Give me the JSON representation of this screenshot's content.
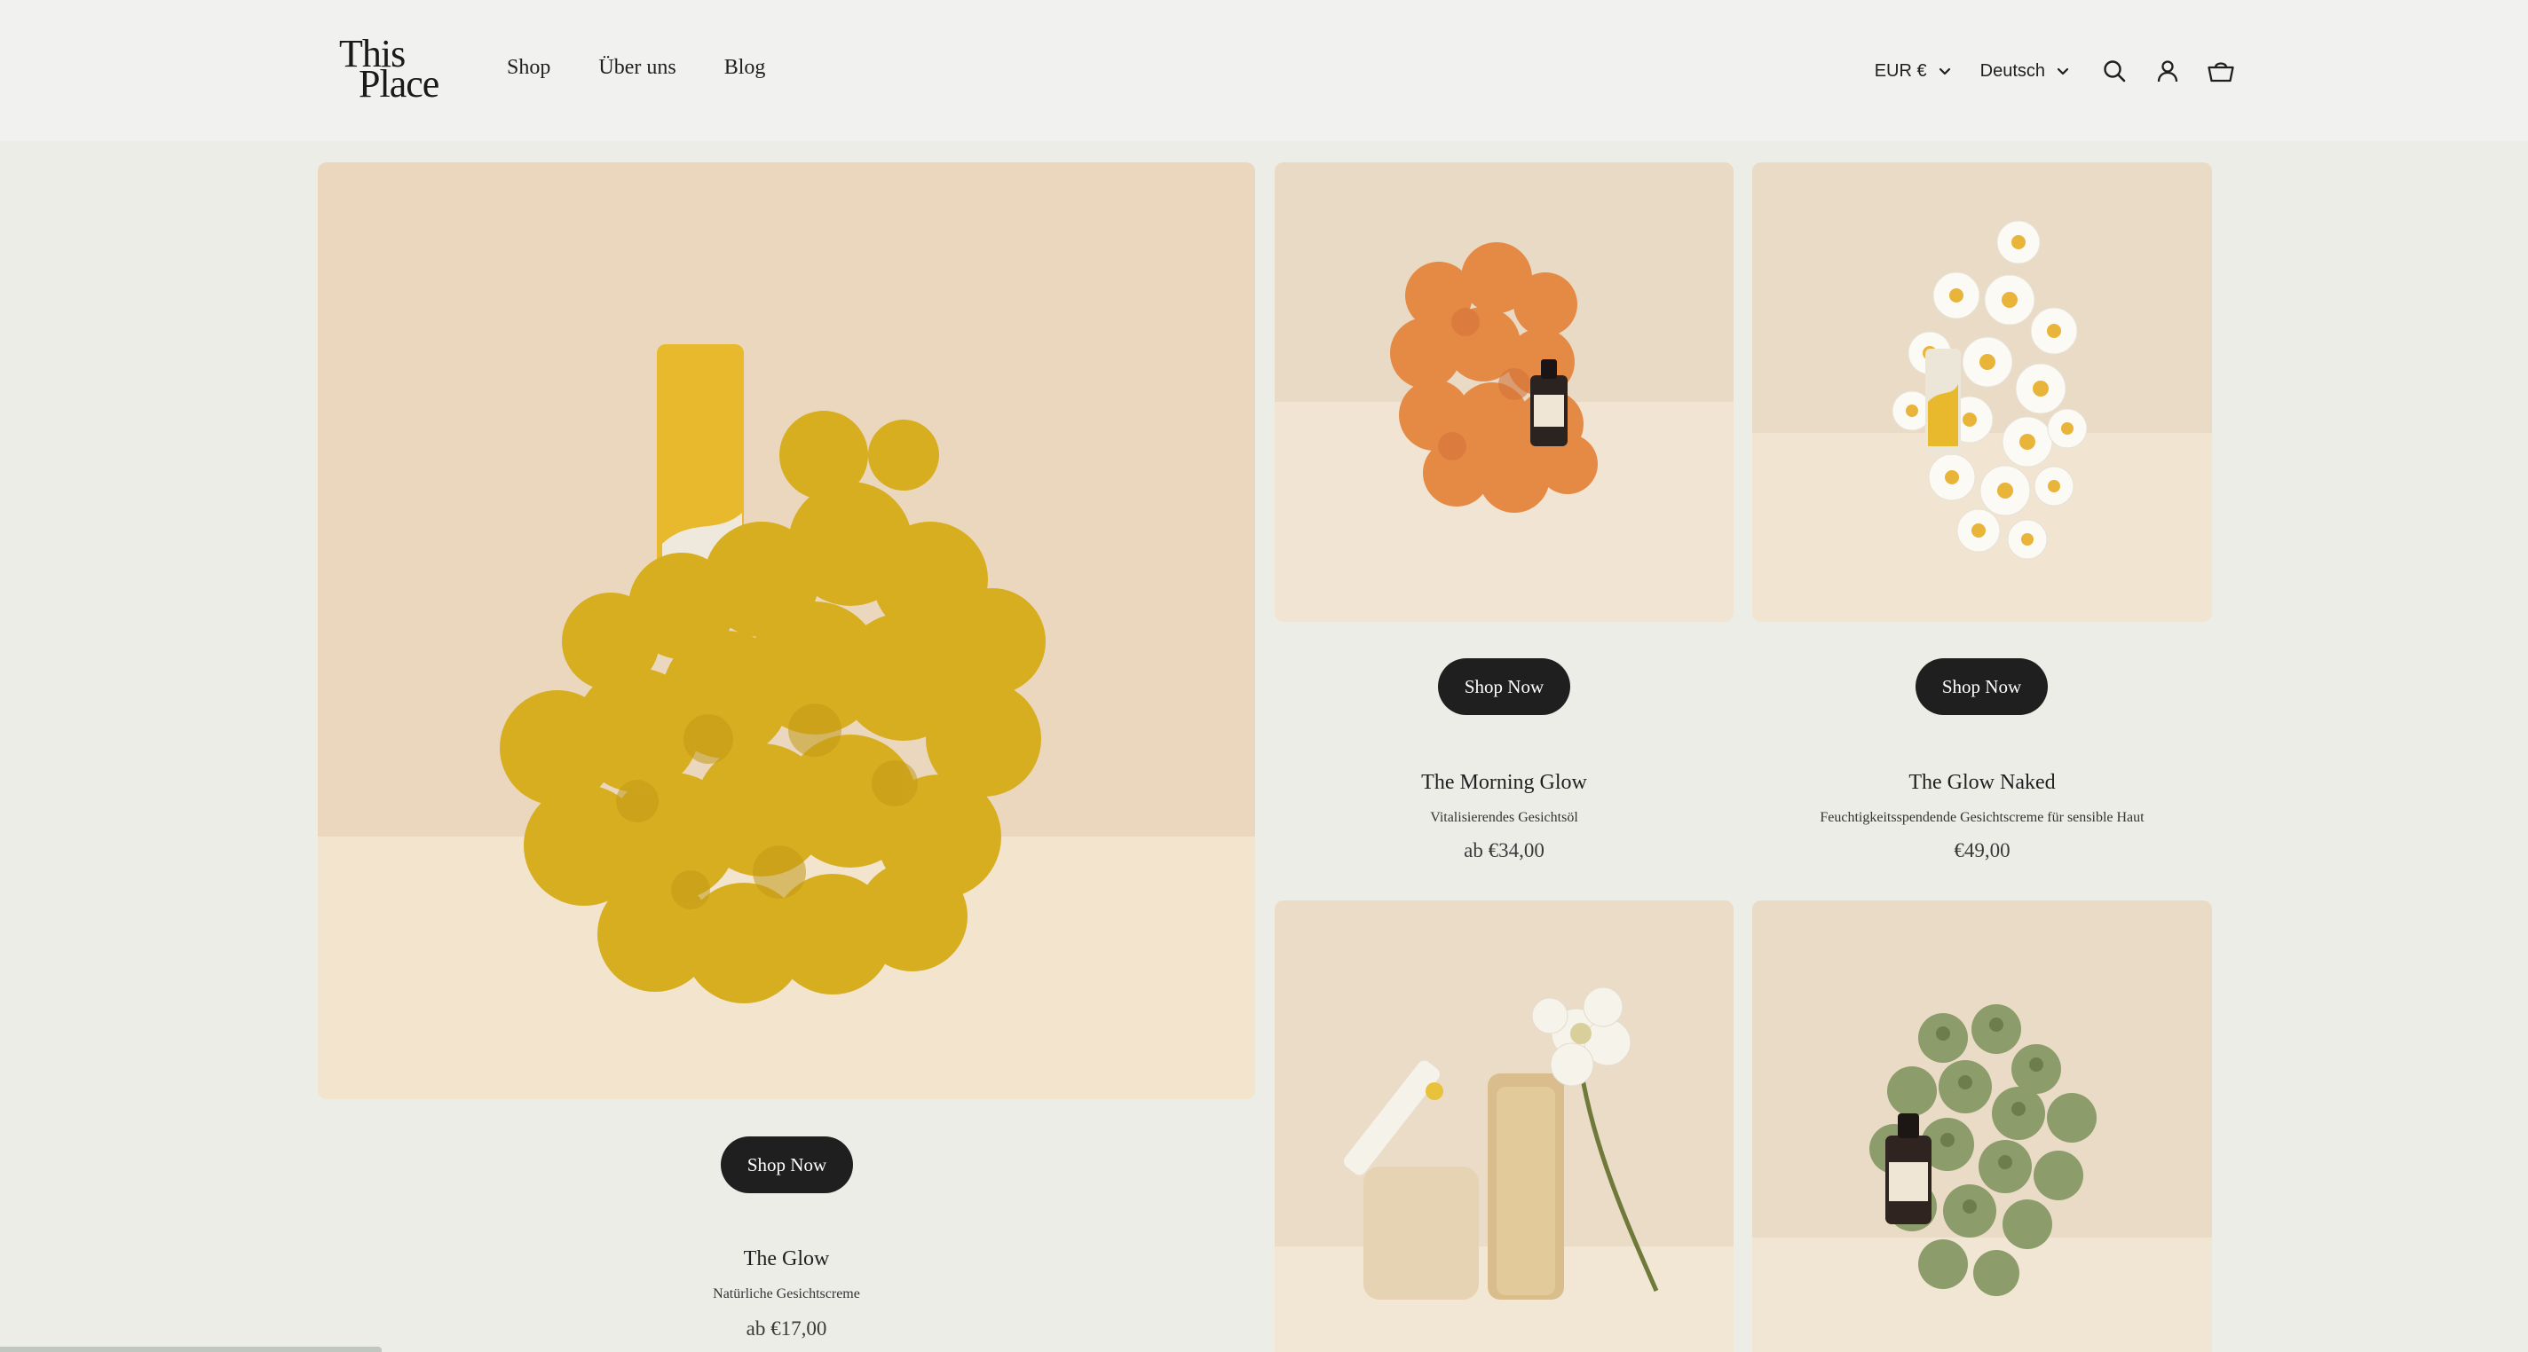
{
  "brand": {
    "line1": "This",
    "line2": "Place"
  },
  "nav": [
    {
      "label": "Shop"
    },
    {
      "label": "Über uns"
    },
    {
      "label": "Blog"
    }
  ],
  "header_tools": {
    "currency": "EUR €",
    "language": "Deutsch",
    "icons": [
      "search-icon",
      "account-icon",
      "cart-icon"
    ]
  },
  "products": [
    {
      "button": "Shop Now",
      "title": "The Glow",
      "subtitle": "Natürliche Gesichtscreme",
      "price": "ab €17,00"
    },
    {
      "button": "Shop Now",
      "title": "The Morning Glow",
      "subtitle": "Vitalisierendes Gesichtsöl",
      "price": "ab €34,00"
    },
    {
      "button": "Shop Now",
      "title": "The Glow Naked",
      "subtitle": "Feuchtigkeitsspendende Gesichtscreme für sensible Haut",
      "price": "€49,00"
    }
  ],
  "colors": {
    "page_bg": "#edede8",
    "header_bg": "#f1f1f0",
    "button_bg": "#1f1f1f",
    "button_text": "#ffffff"
  }
}
